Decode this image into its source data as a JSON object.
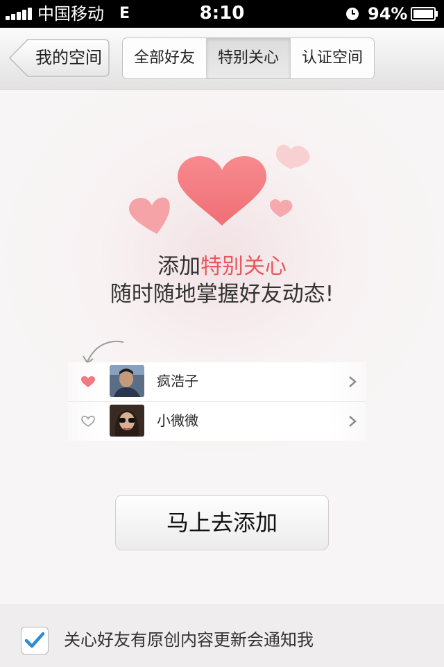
{
  "status_bar": {
    "carrier": "中国移动",
    "network": "E",
    "time": "8:10",
    "battery": "94%"
  },
  "nav": {
    "back_label": "我的空间",
    "tabs": [
      {
        "label": "全部好友",
        "active": false
      },
      {
        "label": "特别关心",
        "active": true
      },
      {
        "label": "认证空间",
        "active": false
      }
    ]
  },
  "promo": {
    "line1_prefix": "添加",
    "line1_highlight": "特别关心",
    "line2": "随时随地掌握好友动态!"
  },
  "friends": [
    {
      "name": "疯浩子",
      "special": true,
      "avatar": "avatar-1"
    },
    {
      "name": "小微微",
      "special": false,
      "avatar": "avatar-2"
    }
  ],
  "add_button": "马上去添加",
  "footer": {
    "checkbox_checked": true,
    "label": "关心好友有原创内容更新会通知我"
  },
  "colors": {
    "accent": "#e8585f",
    "heart": "#f07a80",
    "check": "#2a8ad8"
  }
}
